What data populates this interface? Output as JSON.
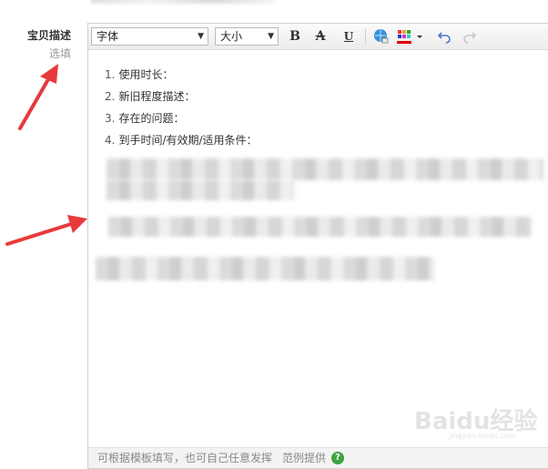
{
  "field": {
    "title": "宝贝描述",
    "optional": "选填"
  },
  "toolbar": {
    "font_select": "字体",
    "size_select": "大小",
    "bold_label": "B",
    "strike_label": "A",
    "underline_label": "U"
  },
  "editor": {
    "items": [
      {
        "num": "1.",
        "text": "使用时长："
      },
      {
        "num": "2.",
        "text": "新旧程度描述："
      },
      {
        "num": "3.",
        "text": "存在的问题："
      },
      {
        "num": "4.",
        "text": "到手时间/有效期/适用条件："
      }
    ]
  },
  "statusbar": {
    "hint": "可根据模板填写，也可自己任意发挥",
    "example": "范例提供",
    "help_icon_text": "?"
  },
  "watermark": {
    "text": "Baidu经验",
    "url": "jingyan.baidu.com"
  },
  "colors": {
    "annotation_arrow": "#e8393a",
    "help_icon": "#3fa33f"
  }
}
